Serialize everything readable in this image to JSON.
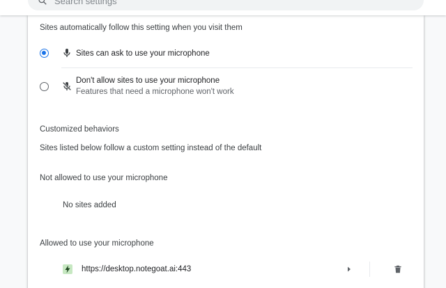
{
  "search": {
    "placeholder": "Search settings"
  },
  "default_behavior": {
    "description": "Sites automatically follow this setting when you visit them",
    "options": [
      {
        "label": "Sites can ask to use your microphone",
        "sublabel": "",
        "selected": true,
        "icon": "microphone-icon"
      },
      {
        "label": "Don't allow sites to use your microphone",
        "sublabel": "Features that need a microphone won't work",
        "selected": false,
        "icon": "microphone-off-icon"
      }
    ]
  },
  "customized": {
    "title": "Customized behaviors",
    "description": "Sites listed below follow a custom setting instead of the default",
    "not_allowed": {
      "title": "Not allowed to use your microphone",
      "empty_text": "No sites added"
    },
    "allowed": {
      "title": "Allowed to use your microphone",
      "sites": [
        {
          "url": "https://desktop.notegoat.ai:443",
          "icon": "notegoat-site-icon"
        }
      ]
    }
  },
  "colors": {
    "accent": "#1a73e8",
    "text": "#202124",
    "secondary_text": "#5f6368",
    "site_icon_bg": "#c7e8c2"
  }
}
